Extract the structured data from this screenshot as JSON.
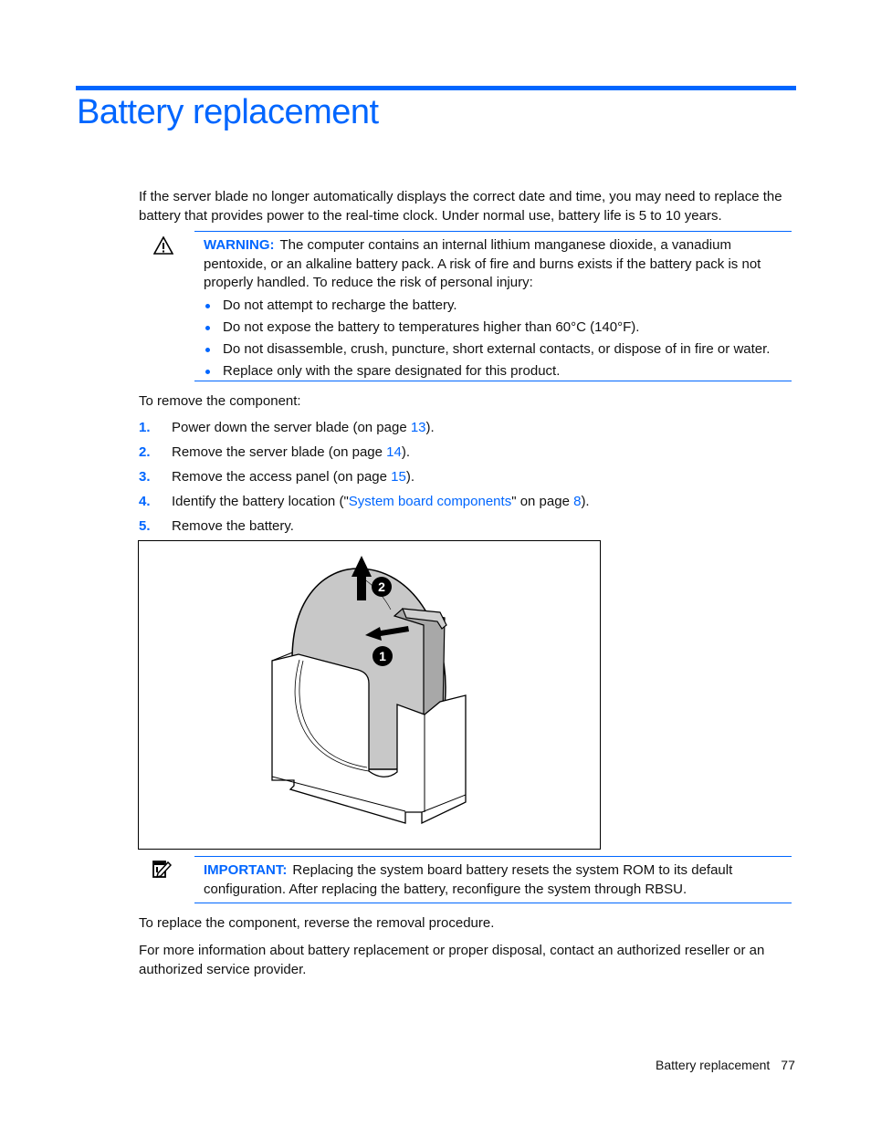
{
  "page": {
    "title": "Battery replacement",
    "intro": "If the server blade no longer automatically displays the correct date and time, you may need to replace the battery that provides power to the real-time clock. Under normal use, battery life is 5 to 10 years.",
    "warning": {
      "icon": "warning-triangle-icon",
      "label": "WARNING:",
      "text": "The computer contains an internal lithium manganese dioxide, a vanadium pentoxide, or an alkaline battery pack. A risk of fire and burns exists if the battery pack is not properly handled. To reduce the risk of personal injury:",
      "bullets": [
        "Do not attempt to recharge the battery.",
        "Do not expose the battery to temperatures higher than 60°C (140°F).",
        "Do not disassemble, crush, puncture, short external contacts, or dispose of in fire or water.",
        "Replace only with the spare designated for this product."
      ]
    },
    "remove_intro": "To remove the component:",
    "steps": [
      {
        "num": "1.",
        "pre": "Power down the server blade (on page ",
        "link": "13",
        "post": ")."
      },
      {
        "num": "2.",
        "pre": "Remove the server blade (on page ",
        "link": "14",
        "post": ")."
      },
      {
        "num": "3.",
        "pre": "Remove the access panel (on page ",
        "link": "15",
        "post": ")."
      },
      {
        "num": "4.",
        "pre": "Identify the battery location (\"",
        "link": "System board components",
        "mid": "\" on page ",
        "link2": "8",
        "post": ")."
      },
      {
        "num": "5.",
        "pre": "Remove the battery.",
        "link": "",
        "post": ""
      }
    ],
    "figure": {
      "callouts": [
        "1",
        "2"
      ]
    },
    "important": {
      "icon": "important-note-icon",
      "label": "IMPORTANT:",
      "text": "Replacing the system board battery resets the system ROM to its default configuration. After replacing the battery, reconfigure the system through RBSU."
    },
    "replace_text": "To replace the component, reverse the removal procedure.",
    "more_info": "For more information about battery replacement or proper disposal, contact an authorized reseller or an authorized service provider.",
    "footer": {
      "section": "Battery replacement",
      "page_number": "77"
    }
  }
}
